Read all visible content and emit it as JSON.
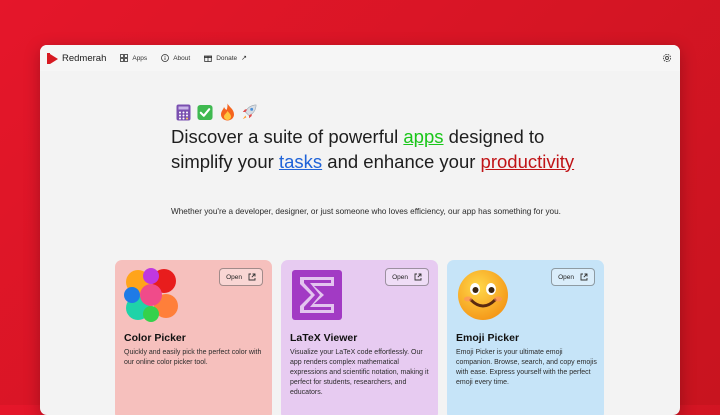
{
  "app": {
    "name": "Redmerah",
    "brand_color": "#d71a22"
  },
  "nav": [
    {
      "label": "Apps",
      "icon": "apps-grid-icon"
    },
    {
      "label": "About",
      "icon": "info-icon"
    },
    {
      "label": "Donate",
      "icon": "gift-icon",
      "external": "↗"
    }
  ],
  "settings_icon": "gear-icon",
  "hero": {
    "emojis": [
      "abacus-emoji",
      "check-mark-emoji",
      "fire-emoji",
      "rocket-emoji"
    ],
    "headline": {
      "part1": "Discover a suite of powerful ",
      "word1": "apps",
      "part2": " designed to simplify your ",
      "word2": "tasks",
      "part3": " and enhance your ",
      "word3": "productivity"
    },
    "subtext": "Whether you're a developer, designer, or just someone who loves efficiency, our app has something for you."
  },
  "cards": [
    {
      "title": "Color Picker",
      "description": "Quickly and easily pick the perfect color with our online color picker tool.",
      "open_label": "Open",
      "icon": "color-wheel-icon",
      "bg": "#f6c0bd"
    },
    {
      "title": "LaTeX Viewer",
      "description": "Visualize your LaTeX code effortlessly. Our app renders complex mathematical expressions and scientific notation, making it perfect for students, researchers, and educators.",
      "open_label": "Open",
      "icon": "sigma-icon",
      "bg": "#e7cbf1"
    },
    {
      "title": "Emoji Picker",
      "description": "Emoji Picker is your ultimate emoji companion. Browse, search, and copy emojis with ease. Express yourself with the perfect emoji every time.",
      "open_label": "Open",
      "icon": "smiley-face-icon",
      "bg": "#c6e4f8"
    }
  ]
}
